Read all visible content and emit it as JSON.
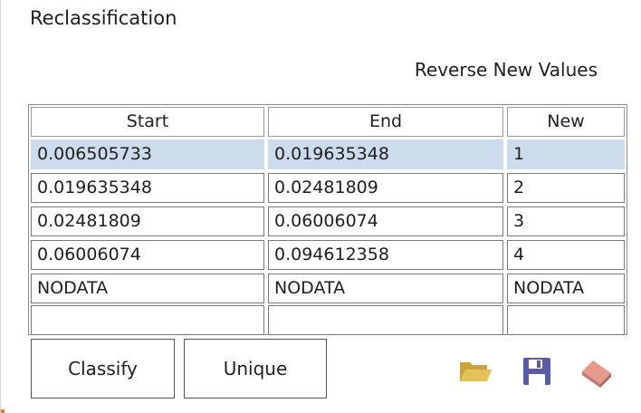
{
  "panel": {
    "title": "Reclassification",
    "reverse_label": "Reverse New Values"
  },
  "table": {
    "columns": [
      "Start",
      "End",
      "New"
    ],
    "rows": [
      {
        "start": "0.006505733",
        "end": "0.019635348",
        "new": "1",
        "selected": true
      },
      {
        "start": "0.019635348",
        "end": "0.02481809",
        "new": "2",
        "selected": false
      },
      {
        "start": "0.02481809",
        "end": "0.06006074",
        "new": "3",
        "selected": false
      },
      {
        "start": "0.06006074",
        "end": "0.094612358",
        "new": "4",
        "selected": false
      },
      {
        "start": "NODATA",
        "end": "NODATA",
        "new": "NODATA",
        "selected": false
      },
      {
        "start": "",
        "end": "",
        "new": "",
        "selected": false
      }
    ]
  },
  "buttons": {
    "classify_label": "Classify",
    "unique_label": "Unique"
  },
  "icons": {
    "open": "folder-open-icon",
    "save": "save-icon",
    "clear": "eraser-icon"
  },
  "colors": {
    "selection": "#cddcec",
    "folder": "#e3c25a",
    "save": "#5a5aa8",
    "eraser": "#e49a8c"
  }
}
